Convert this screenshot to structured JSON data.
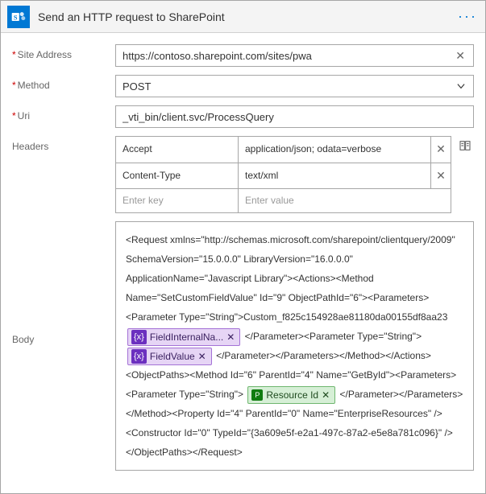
{
  "header": {
    "title": "Send an HTTP request to SharePoint"
  },
  "fields": {
    "siteAddress": {
      "label": "Site Address",
      "value": "https://contoso.sharepoint.com/sites/pwa"
    },
    "method": {
      "label": "Method",
      "value": "POST"
    },
    "uri": {
      "label": "Uri",
      "value": "_vti_bin/client.svc/ProcessQuery"
    },
    "headersLabel": "Headers",
    "bodyLabel": "Body",
    "headers": {
      "rows": [
        {
          "key": "Accept",
          "value": "application/json; odata=verbose"
        },
        {
          "key": "Content-Type",
          "value": "text/xml"
        }
      ],
      "placeholderKey": "Enter key",
      "placeholderValue": "Enter value"
    },
    "body": {
      "seg0": "<Request xmlns=\"http://schemas.microsoft.com/sharepoint/clientquery/2009\" SchemaVersion=\"15.0.0.0\" LibraryVersion=\"16.0.0.0\" ApplicationName=\"Javascript Library\"><Actions><Method Name=\"SetCustomFieldValue\" Id=\"9\" ObjectPathId=\"6\"><Parameters><Parameter Type=\"String\">Custom_f825c154928ae81180da00155df8aa23",
      "tok1": "FieldInternalNa...",
      "seg1": "</Parameter><Parameter Type=\"String\">",
      "tok2": "FieldValue",
      "seg2": "</Parameter></Parameters></Method></Actions><ObjectPaths><Method Id=\"6\" ParentId=\"4\" Name=\"GetById\"><Parameters><Parameter Type=\"String\">",
      "tok3": "Resource Id",
      "seg3": "</Parameter></Parameters></Method><Property Id=\"4\" ParentId=\"0\" Name=\"EnterpriseResources\" /><Constructor Id=\"0\" TypeId=\"{3a609e5f-e2a1-497c-87a2-e5e8a781c096}\" /></ObjectPaths></Request>"
    }
  }
}
